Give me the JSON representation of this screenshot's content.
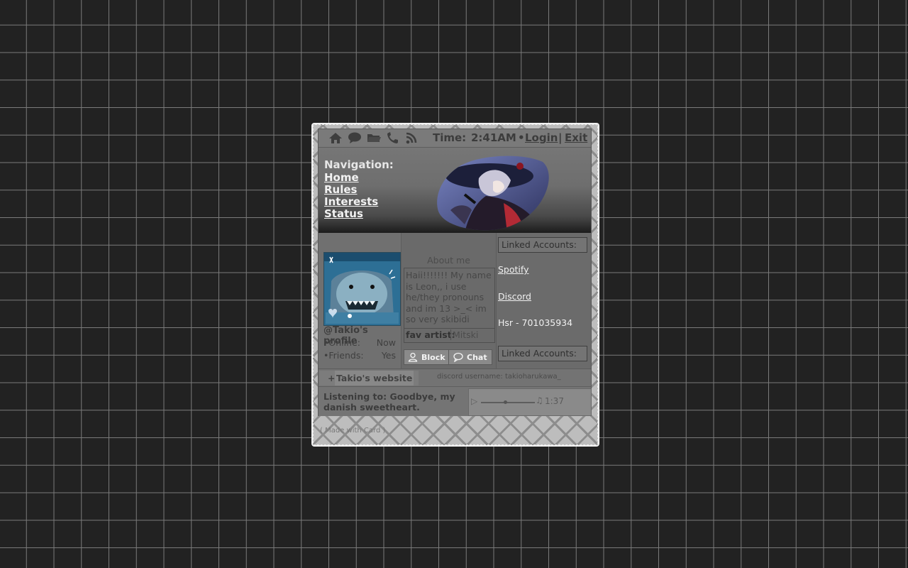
{
  "topbar": {
    "icons": [
      "home-icon",
      "chat-bubble-icon",
      "folder-icon",
      "phone-icon",
      "rss-icon"
    ],
    "time_label": "Time:",
    "time_value": "2:41AM",
    "bullet": "•",
    "login": "Login",
    "separator": "|",
    "exit": "Exit"
  },
  "nav": {
    "title": "Navigation:",
    "links": [
      "Home",
      "Rules",
      "Interests",
      "Status"
    ]
  },
  "profile": {
    "handle": "@Takio's profile",
    "online_label": "•Online:",
    "online_value": "Now",
    "friends_label": "•Friends:",
    "friends_value": "Yes"
  },
  "about": {
    "heading": "About me",
    "text": "Haii!!!!!!! My name is Leon,, i use he/they pronouns and im 13 >_< im so very skibidi",
    "fav_label": "fav artist:",
    "fav_value": "Mitski",
    "block_label": "Block",
    "chat_label": "Chat"
  },
  "accounts": {
    "header": "Linked Accounts:",
    "spotify": "Spotify",
    "discord": "Discord",
    "hsr": "Hsr - 701035934",
    "footer_header": "Linked Accounts:"
  },
  "strip": {
    "plus": "+",
    "website": "Takio's website",
    "discord_username": "discord username: takioharukawa_"
  },
  "music": {
    "listening": "Listening to: Goodbye, my danish sweetheart.",
    "play_icon": "▷",
    "note_icon": "♫",
    "duration": "1:37",
    "progress": 0.45
  },
  "footer": {
    "made_with": "( Made with Card )"
  }
}
